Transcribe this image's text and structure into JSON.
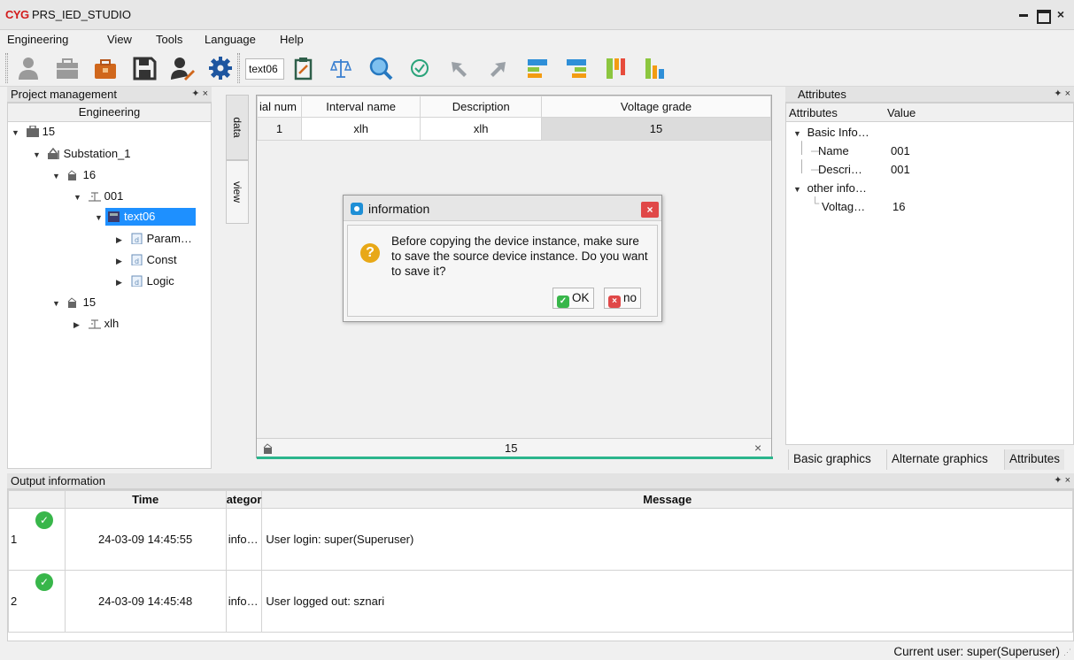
{
  "window": {
    "logo": "CYG",
    "title": "PRS_IED_STUDIO"
  },
  "menu": [
    "Engineering",
    "View",
    "Tools",
    "Language",
    "Help"
  ],
  "toolbar": {
    "combo_value": "text06"
  },
  "project_panel": {
    "title": "Project management",
    "pin": "✦ ×",
    "column": "Engineering",
    "tree": [
      {
        "label": "15",
        "icon": "project-icon"
      },
      {
        "label": "Substation_1",
        "icon": "substation-icon"
      },
      {
        "label": "16",
        "icon": "voltage-level-icon"
      },
      {
        "label": "001",
        "icon": "bay-icon"
      },
      {
        "label": "text06",
        "icon": "device-icon",
        "selected": true
      },
      {
        "label": "Param…",
        "icon": "data-set-icon"
      },
      {
        "label": "Const",
        "icon": "data-set-icon"
      },
      {
        "label": "Logic",
        "icon": "data-set-icon"
      },
      {
        "label": "15",
        "icon": "voltage-level-icon"
      },
      {
        "label": "xlh",
        "icon": "bay-icon"
      }
    ]
  },
  "side_tabs": [
    "data",
    "view"
  ],
  "grid": {
    "columns": [
      "ial num",
      "Interval name",
      "Description",
      "Voltage grade"
    ],
    "rows": [
      [
        "1",
        "xlh",
        "xlh",
        "15"
      ]
    ],
    "footer_value": "15",
    "footer_close": "×"
  },
  "dialog": {
    "title": "information",
    "close": "×",
    "message": "Before copying the device instance, make sure to save the source device instance. Do you want to save it?",
    "ok_label": "OK",
    "no_label": "no"
  },
  "attributes_panel": {
    "title": "Attributes",
    "pin": "✦ ×",
    "columns": [
      "Attributes",
      "Value"
    ],
    "rows": [
      {
        "name": "Basic Info…",
        "value": ""
      },
      {
        "name": "Name",
        "value": "001"
      },
      {
        "name": "Descri…",
        "value": "001"
      },
      {
        "name": "other info…",
        "value": ""
      },
      {
        "name": "Voltag…",
        "value": "16"
      }
    ],
    "tabs": [
      "Basic graphics",
      "Alternate graphics",
      "Attributes"
    ]
  },
  "output_panel": {
    "title": "Output information",
    "pin": "✦ ×",
    "columns": [
      "",
      "Time",
      "ategor",
      "Message"
    ],
    "rows": [
      {
        "index": "1",
        "time": "24-03-09 14:45:55",
        "category": "info…",
        "message": "User login: super(Superuser)"
      },
      {
        "index": "2",
        "time": "24-03-09 14:45:48",
        "category": "info…",
        "message": "User logged out: sznari"
      }
    ]
  },
  "status": {
    "user": "Current user: super(Superuser)"
  },
  "colors": {
    "selection": "#1e90ff",
    "accent_line": "#2bb58c",
    "logo_red": "#d21c1c",
    "ok_green": "#38b64a"
  }
}
